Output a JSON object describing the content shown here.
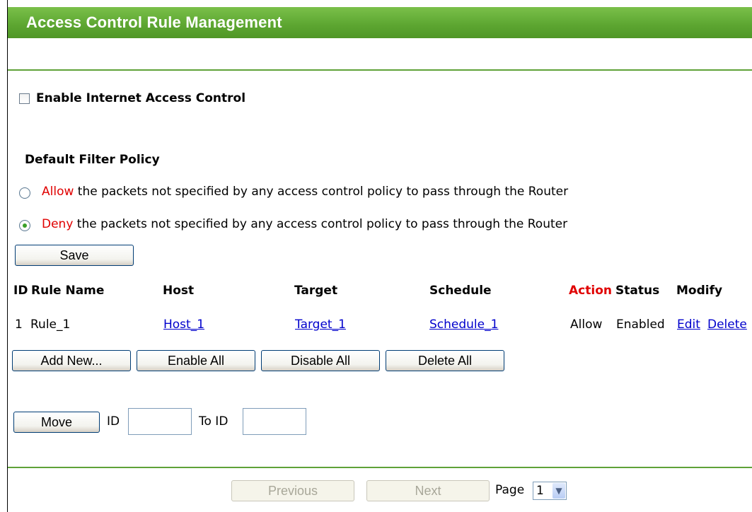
{
  "header": {
    "title": "Access Control Rule Management"
  },
  "enable_control": {
    "label": "Enable Internet Access Control",
    "checked": false
  },
  "filter_policy": {
    "heading": "Default Filter Policy",
    "options": [
      {
        "keyword": "Allow",
        "text": " the packets not specified by any access control policy to pass through the Router",
        "selected": false
      },
      {
        "keyword": "Deny",
        "text": " the packets not specified by any access control policy to pass through the Router",
        "selected": true
      }
    ],
    "save_label": "Save"
  },
  "rules_table": {
    "headers": {
      "id": "ID",
      "rule_name": "Rule Name",
      "host": "Host",
      "target": "Target",
      "schedule": "Schedule",
      "action": "Action",
      "status": "Status",
      "modify": "Modify"
    },
    "rows": [
      {
        "id": "1",
        "rule_name": "Rule_1",
        "host": "Host_1",
        "target": "Target_1",
        "schedule": "Schedule_1",
        "action": "Allow",
        "status": "Enabled",
        "edit": "Edit",
        "delete": "Delete"
      }
    ]
  },
  "table_actions": {
    "add_new": "Add New...",
    "enable_all": "Enable All",
    "disable_all": "Disable All",
    "delete_all": "Delete All"
  },
  "move": {
    "button": "Move",
    "id_label": "ID",
    "id_value": "",
    "to_id_label": "To ID",
    "to_id_value": ""
  },
  "pagination": {
    "previous": "Previous",
    "next": "Next",
    "page_label": "Page",
    "page_value": "1"
  },
  "colors": {
    "header_green": "#5ea732",
    "divider_green": "#5fa238",
    "action_red": "#e00000",
    "link_blue": "#0000cc"
  }
}
